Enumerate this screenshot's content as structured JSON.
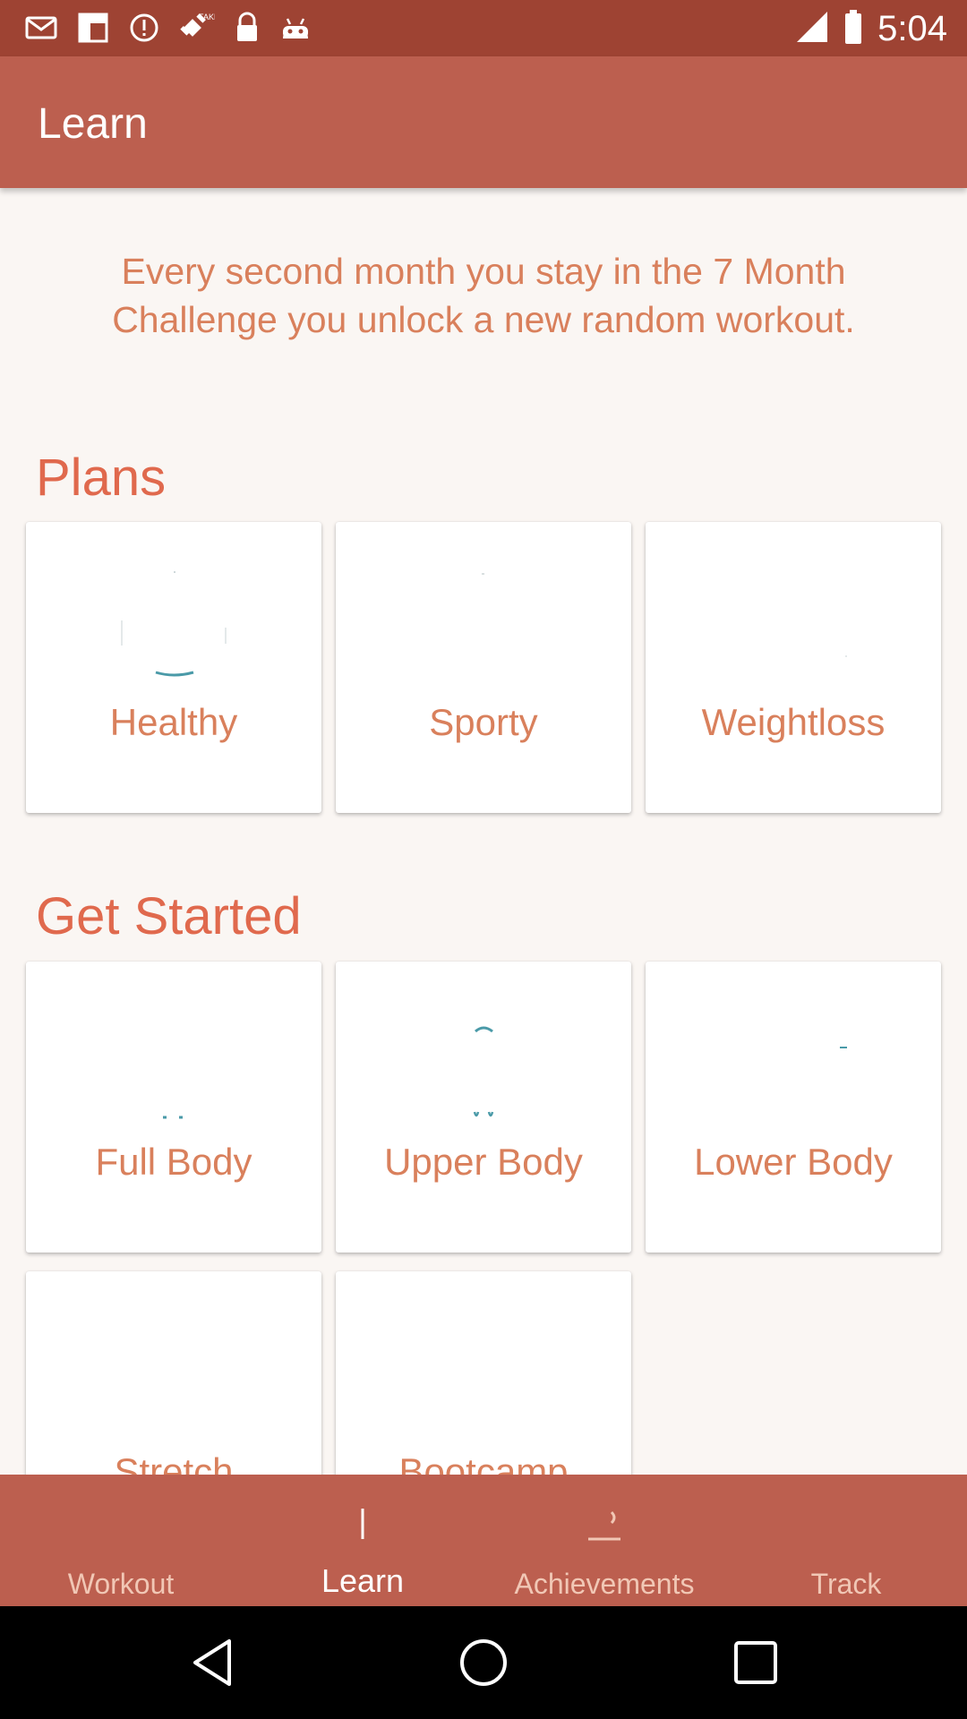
{
  "status_bar": {
    "time": "5:04",
    "left_icons": [
      "mail-icon",
      "flipboard-icon",
      "alert-icon",
      "fake-gps-icon",
      "lock-icon",
      "android-icon"
    ],
    "right_icons": [
      "signal-icon",
      "battery-icon"
    ]
  },
  "app_bar": {
    "title": "Learn"
  },
  "intro_text": "Every second month you stay in the 7 Month Challenge you unlock a new random workout.",
  "sections": {
    "plans": {
      "title": "Plans",
      "cards": [
        {
          "label": "Healthy",
          "icon": "healthy-icon"
        },
        {
          "label": "Sporty",
          "icon": "sporty-icon"
        },
        {
          "label": "Weightloss",
          "icon": "weightloss-icon"
        }
      ]
    },
    "get_started": {
      "title": "Get Started",
      "cards": [
        {
          "label": "Full Body",
          "icon": "full-body-icon"
        },
        {
          "label": "Upper Body",
          "icon": "upper-body-icon"
        },
        {
          "label": "Lower Body",
          "icon": "lower-body-icon"
        },
        {
          "label": "Stretch",
          "icon": "stretch-icon"
        },
        {
          "label": "Bootcamp",
          "icon": "bootcamp-icon"
        }
      ]
    }
  },
  "bottom_nav": {
    "items": [
      {
        "label": "Workout",
        "icon": "workout-icon",
        "active": false
      },
      {
        "label": "Learn",
        "icon": "learn-icon",
        "active": true
      },
      {
        "label": "Achievements",
        "icon": "achievements-icon",
        "active": false
      },
      {
        "label": "Track",
        "icon": "track-icon",
        "active": false
      }
    ]
  },
  "colors": {
    "status_bar": "#9e4333",
    "app_bar": "#bc5f4f",
    "accent_text": "#d9805c",
    "section_title": "#e0694d",
    "background": "#faf6f3",
    "icon_teal": "#4a9aa8"
  }
}
